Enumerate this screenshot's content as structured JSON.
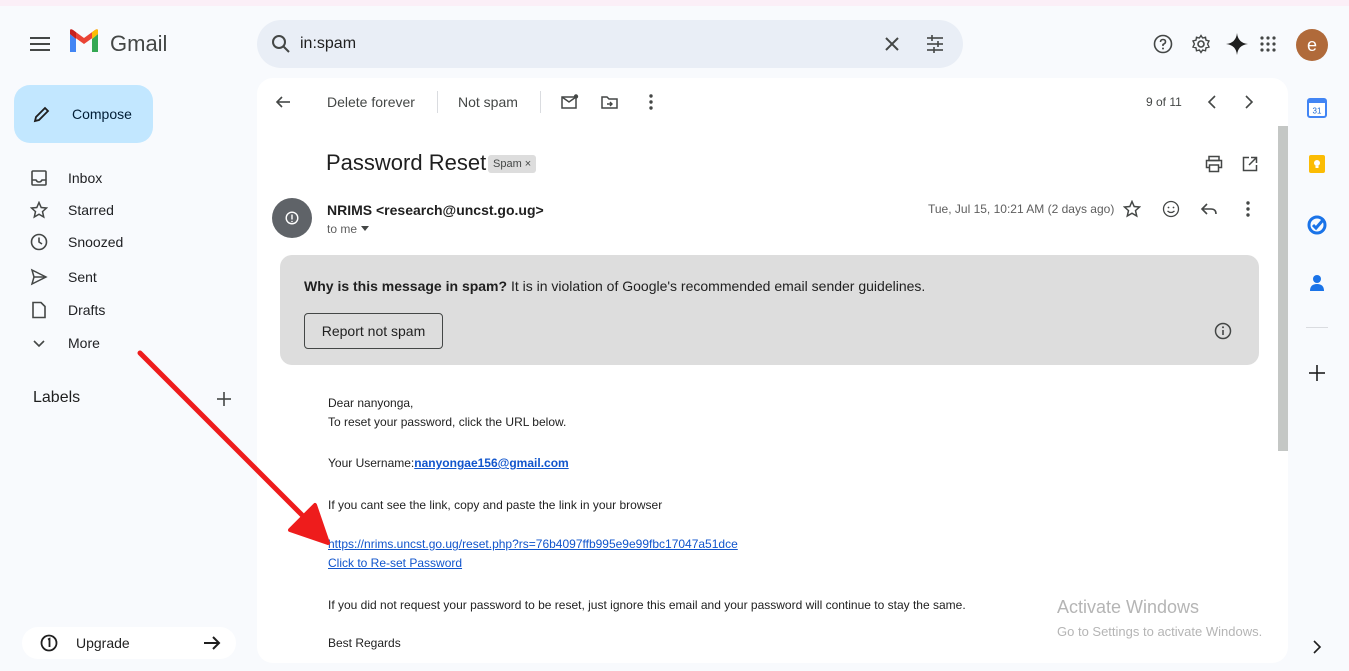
{
  "header": {
    "brand": "Gmail",
    "search_value": "in:spam",
    "avatar_letter": "e",
    "colors": {
      "red": "#ea4335",
      "blue": "#4285f4",
      "green": "#34a853",
      "yellow": "#fbbc04"
    }
  },
  "sidebar": {
    "compose": "Compose",
    "items": [
      {
        "label": "Inbox",
        "icon": "inbox-icon"
      },
      {
        "label": "Starred",
        "icon": "star-icon"
      },
      {
        "label": "Snoozed",
        "icon": "clock-icon"
      },
      {
        "label": "Sent",
        "icon": "send-icon"
      },
      {
        "label": "Drafts",
        "icon": "draft-icon"
      },
      {
        "label": "More",
        "icon": "chevron-down-icon"
      }
    ],
    "labels_title": "Labels",
    "upgrade": "Upgrade"
  },
  "toolbar": {
    "delete_forever": "Delete forever",
    "not_spam": "Not spam",
    "pager": "9 of 11"
  },
  "message": {
    "subject": "Password Reset",
    "spam_chip": "Spam",
    "sender": "NRIMS <research@uncst.go.ug>",
    "to_me": "to me",
    "date": "Tue, Jul 15, 10:21 AM (2 days ago)",
    "spam_notice_bold": "Why is this message in spam?",
    "spam_notice_text": " It is in violation of Google's recommended email sender guidelines.",
    "report_not_spam": "Report not spam",
    "body": {
      "greeting": "Dear nanyonga,",
      "instruction": "To reset your password, click the URL below.",
      "username_label": "Your Username:",
      "username_value": "nanyongae156@gmail.com",
      "copy_note": "If you cant see the link, copy and paste the link in your browser",
      "reset_url": "https://nrims.uncst.go.ug/reset.php?rs=76b4097ffb995e9e99fbc17047a51dce",
      "reset_link_text": "Click to Re-set Password",
      "ignore_note": "If you did not request your password to be reset, just ignore this email and your password will continue to stay the same.",
      "signoff": "Best Regards"
    }
  },
  "watermark": {
    "title": "Activate Windows",
    "subtitle": "Go to Settings to activate Windows."
  },
  "annotation": {
    "arrow_color": "#ee1c1c"
  }
}
